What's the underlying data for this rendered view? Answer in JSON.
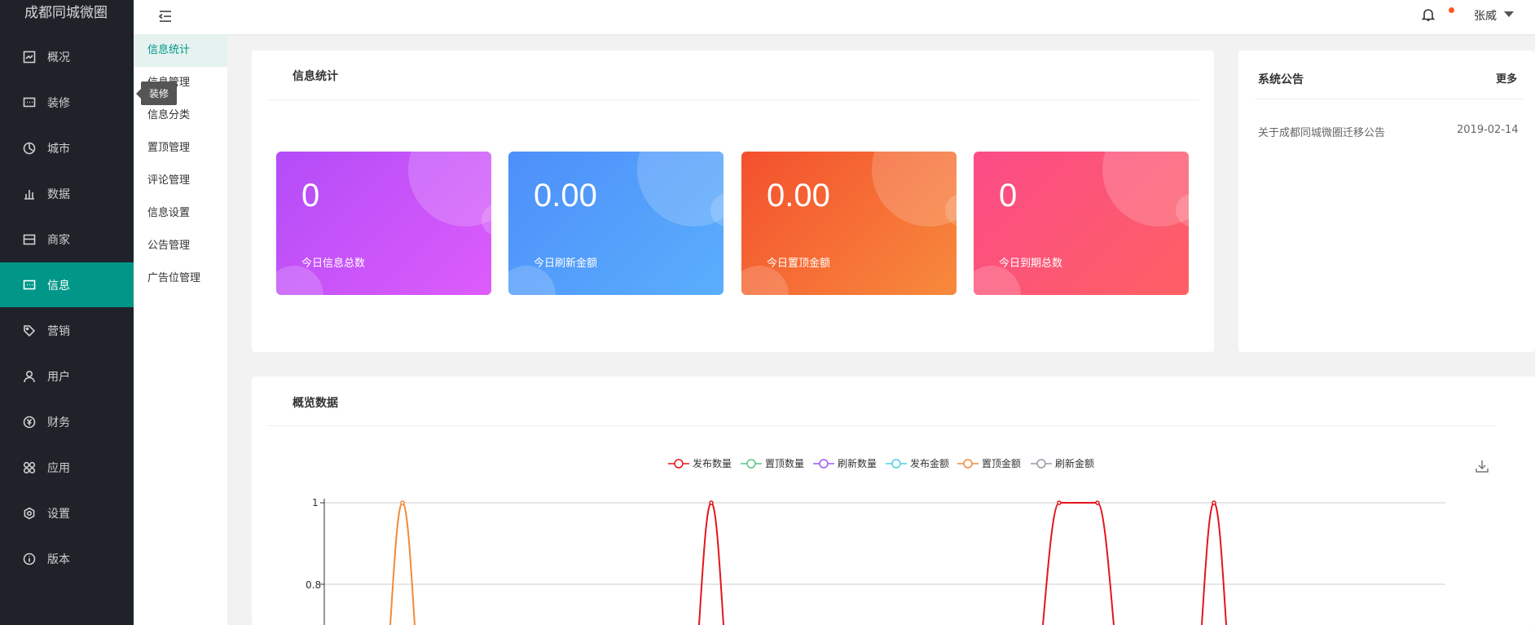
{
  "brand": "成都同城微圈",
  "sidebar": {
    "items": [
      {
        "label": "概况",
        "icon": "dashboard-icon"
      },
      {
        "label": "装修",
        "icon": "decorate-icon"
      },
      {
        "label": "城市",
        "icon": "city-icon"
      },
      {
        "label": "数据",
        "icon": "bar-chart-icon"
      },
      {
        "label": "商家",
        "icon": "store-icon"
      },
      {
        "label": "信息",
        "icon": "message-icon"
      },
      {
        "label": "营销",
        "icon": "tag-icon"
      },
      {
        "label": "用户",
        "icon": "user-icon"
      },
      {
        "label": "财务",
        "icon": "yen-icon"
      },
      {
        "label": "应用",
        "icon": "apps-icon"
      },
      {
        "label": "设置",
        "icon": "settings-icon"
      },
      {
        "label": "版本",
        "icon": "info-icon"
      }
    ],
    "active_index": 5
  },
  "submenu": {
    "items": [
      "信息统计",
      "信息管理",
      "信息分类",
      "置顶管理",
      "评论管理",
      "信息设置",
      "公告管理",
      "广告位管理"
    ],
    "active_index": 0
  },
  "tooltip": "装修",
  "header": {
    "user": "张威"
  },
  "stats_panel": {
    "title": "信息统计",
    "cards": [
      {
        "value": "0",
        "label": "今日信息总数",
        "colors": [
          "#b34cf8",
          "#dd5cfa"
        ]
      },
      {
        "value": "0.00",
        "label": "今日刷新金额",
        "colors": [
          "#4d8ffa",
          "#5aaefc"
        ]
      },
      {
        "value": "0.00",
        "label": "今日置顶金额",
        "colors": [
          "#f4502e",
          "#f78a3c"
        ]
      },
      {
        "value": "0",
        "label": "今日到期总数",
        "colors": [
          "#fb4c87",
          "#fe6064"
        ]
      }
    ]
  },
  "notice": {
    "title": "系统公告",
    "more": "更多",
    "items": [
      {
        "title": "关于成都同城微圈迁移公告",
        "date": "2019-02-14"
      }
    ]
  },
  "overview": {
    "title": "概览数据"
  },
  "chart_data": {
    "type": "line",
    "legend_position": "top-center",
    "series": [
      {
        "name": "发布数量",
        "color": "#e6141c"
      },
      {
        "name": "置顶数量",
        "color": "#5cc48a"
      },
      {
        "name": "刷新数量",
        "color": "#9b59f5"
      },
      {
        "name": "发布金额",
        "color": "#4dd0e1"
      },
      {
        "name": "置顶金额",
        "color": "#f08a3c"
      },
      {
        "name": "刷新金额",
        "color": "#999aa8"
      }
    ],
    "y_tick_labels": [
      "1",
      "0.8"
    ],
    "ylim": [
      0,
      1
    ],
    "grid": true
  }
}
